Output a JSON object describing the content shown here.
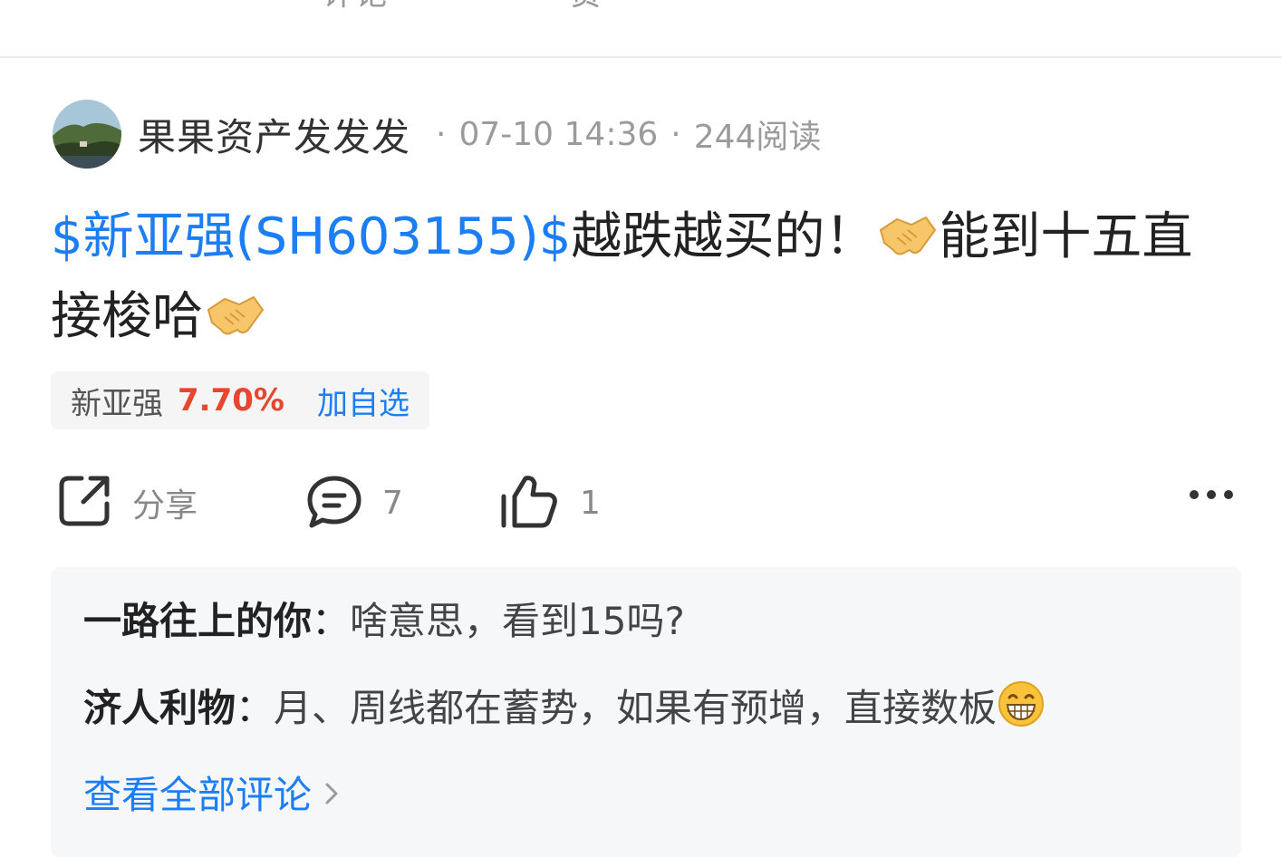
{
  "top_bar": {
    "comment_cut": "评论",
    "like_cut": "赞"
  },
  "post": {
    "author": "果果资产发发发",
    "time": "07-10 14:36",
    "reads": "244阅读",
    "separator": "·",
    "body": {
      "stock_link": "$新亚强(SH603155)$",
      "text_1": "越跌越买的！",
      "text_2": "能到十五直接梭哈"
    },
    "emoji": {
      "handshake": "handshake-emoji"
    }
  },
  "stock_tag": {
    "name": "新亚强",
    "change": "7.70%",
    "add_label": "加自选",
    "change_color": "#e8472f"
  },
  "actions": {
    "share_label": "分享",
    "comment_count": "7",
    "like_count": "1"
  },
  "comments": [
    {
      "user": "一路往上的你",
      "colon": "：",
      "text": "啥意思，看到15吗?"
    },
    {
      "user": "济人利物",
      "colon": "：",
      "text": "月、周线都在蓄势，如果有预增，直接数板"
    }
  ],
  "view_all_label": "查看全部评论",
  "colors": {
    "link": "#1b7ef5",
    "rise": "#e8472f",
    "muted": "#9b9b9b"
  }
}
